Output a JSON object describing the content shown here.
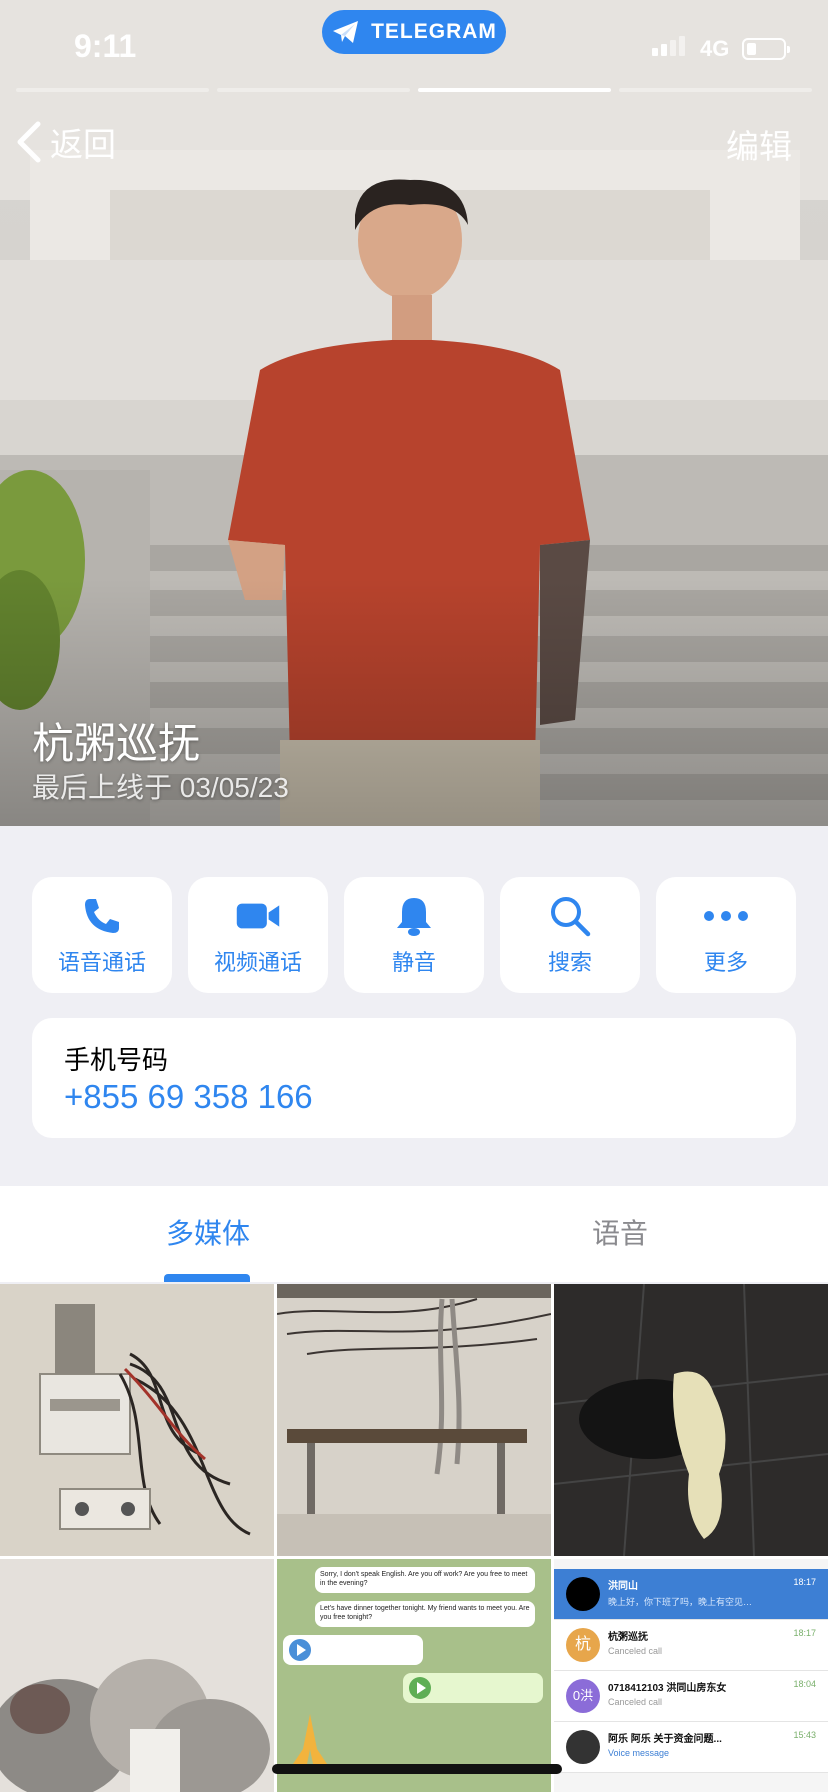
{
  "status_bar": {
    "time": "9:11",
    "app_pill": "TELEGRAM",
    "network": "4G",
    "battery_level": 0.25
  },
  "nav": {
    "back_label": "返回",
    "edit_label": "编辑"
  },
  "profile": {
    "name": "杭粥巡抚",
    "last_seen": "最后上线于 03/05/23"
  },
  "actions": [
    {
      "label": "语音通话",
      "icon": "phone-icon"
    },
    {
      "label": "视频通话",
      "icon": "video-icon"
    },
    {
      "label": "静音",
      "icon": "bell-icon"
    },
    {
      "label": "搜索",
      "icon": "search-icon"
    },
    {
      "label": "更多",
      "icon": "more-icon"
    }
  ],
  "phone": {
    "label": "手机号码",
    "value": "+855 69 358 166"
  },
  "tabs": [
    {
      "label": "多媒体",
      "active": true
    },
    {
      "label": "语音",
      "active": false
    }
  ],
  "colors": {
    "accent": "#2f86ef",
    "page_bg": "#efeff4"
  },
  "media": {
    "chat_screenshot": {
      "bubbles": [
        "Sorry, I don't speak English. Are you off work? Are you free to meet in the evening?",
        "Let's have dinner together tonight. My friend wants to meet you. Are you free tonight?"
      ],
      "rows": [
        {
          "name": "洪同山",
          "sub": "晚上好，你下班了吗，晚上有空见…",
          "time": "18:17"
        },
        {
          "name": "杭粥巡抚",
          "sub": "Canceled call",
          "time": "18:17",
          "avatar_text": "杭"
        },
        {
          "name": "0718412103 洪同山房东女",
          "sub": "Canceled call",
          "time": "18:04",
          "avatar_text": "0洪"
        },
        {
          "name": "阿乐 阿乐 关于资金问题...",
          "sub": "Voice message",
          "time": "15:43"
        }
      ]
    }
  }
}
